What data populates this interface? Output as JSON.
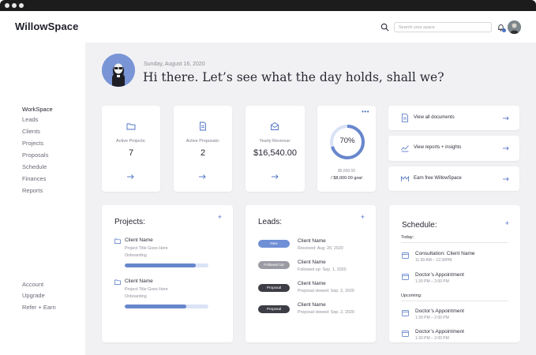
{
  "app": {
    "brand": "WillowSpace"
  },
  "header": {
    "search_placeholder": "Search your space"
  },
  "sidebar": {
    "primary": [
      "WorkSpace",
      "Leads",
      "Clients",
      "Projects",
      "Proposals",
      "Schedule",
      "Finances",
      "Reports"
    ],
    "secondary": [
      "Account",
      "Upgrade",
      "Refer + Earn"
    ]
  },
  "hero": {
    "date": "Sunday, August 16, 2020",
    "greeting": "Hi there. Let’s see what the day holds, shall we?"
  },
  "stats": [
    {
      "label": "Active Projects:",
      "value": "7",
      "icon": "folder-icon"
    },
    {
      "label": "Active Proposals:",
      "value": "2",
      "icon": "document-icon"
    },
    {
      "label": "Yearly Revenue:",
      "value": "$16,540.00",
      "icon": "inbox-icon"
    }
  ],
  "goal": {
    "percent_label": "70%",
    "progress": 0.7,
    "current": "$5,600.00",
    "goal_text": "/ $8,000.00 goal",
    "menu": "•••"
  },
  "quick_links": [
    {
      "label": "View all documents",
      "icon": "document-icon"
    },
    {
      "label": "View reports + insights",
      "icon": "chart-icon"
    },
    {
      "label": "Earn free WillowSpace",
      "icon": "gift-icon"
    }
  ],
  "projects": {
    "title": "Projects:",
    "add": "+",
    "items": [
      {
        "client": "Client Name",
        "title": "Project Title Goes Here",
        "status": "Onboarding",
        "progress": 0.85
      },
      {
        "client": "Client Name",
        "title": "Project Title Goes Here",
        "status": "Onboarding",
        "progress": 0.74
      }
    ]
  },
  "leads": {
    "title": "Leads:",
    "add": "+",
    "items": [
      {
        "badge": "New",
        "badge_color": "#6f8fd6",
        "name": "Client Name",
        "detail": "Received: Aug. 20, 2020"
      },
      {
        "badge": "Followed Up",
        "badge_color": "#9a9aa3",
        "name": "Client Name",
        "detail": "Followed up: Sep. 1, 2020"
      },
      {
        "badge": "Proposal",
        "badge_color": "#3d3d46",
        "name": "Client Name",
        "detail": "Proposal viewed: Sep. 2, 2020"
      },
      {
        "badge": "Proposal",
        "badge_color": "#3d3d46",
        "name": "Client Name",
        "detail": "Proposal viewed: Sep. 2, 2020"
      }
    ]
  },
  "schedule": {
    "title": "Schedule:",
    "add": "+",
    "today_label": "Today:",
    "upcoming_label": "Upcoming:",
    "today": [
      {
        "name": "Consultation: Client Name",
        "time": "11:30 AM – 12:30PM"
      },
      {
        "name": "Doctor’s Appointment",
        "time": "1:30 PM – 2:00 PM"
      }
    ],
    "upcoming": [
      {
        "name": "Doctor’s Appointment",
        "time": "1:30 PM – 2:00 PM"
      },
      {
        "name": "Doctor’s Appointment",
        "time": "1:30 PM – 2:00 PM"
      }
    ]
  },
  "colors": {
    "accent": "#4b6fc3",
    "ring_track": "#d9e2f5",
    "ring_fill": "#6786cc"
  }
}
